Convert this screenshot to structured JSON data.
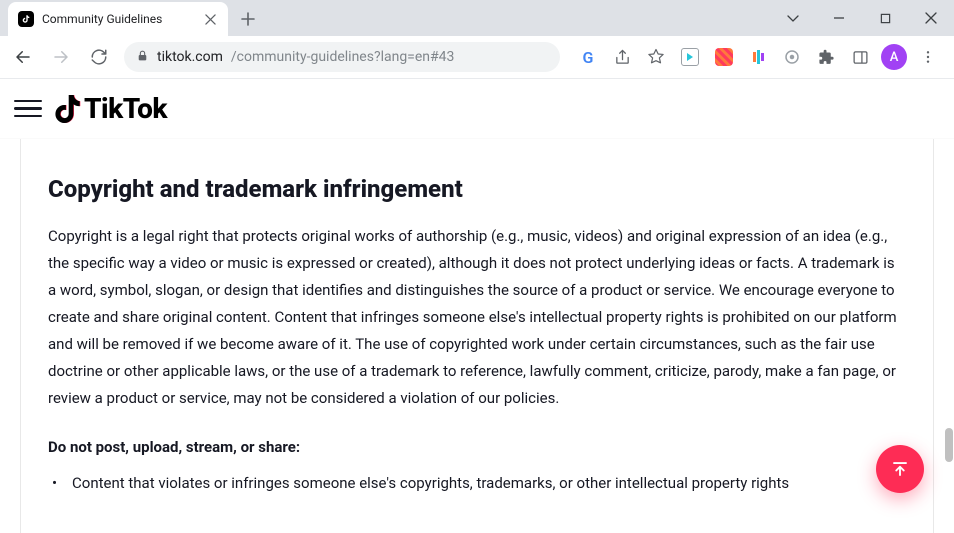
{
  "browser": {
    "tab_title": "Community Guidelines",
    "url_host": "tiktok.com",
    "url_path": "/community-guidelines?lang=en#43",
    "avatar_letter": "A"
  },
  "page": {
    "brand": "TikTok",
    "heading": "Copyright and trademark infringement",
    "paragraph": "Copyright is a legal right that protects original works of authorship (e.g., music, videos) and original expression of an idea (e.g., the specific way a video or music is expressed or created), although it does not protect underlying ideas or facts. A trademark is a word, symbol, slogan, or design that identifies and distinguishes the source of a product or service. We encourage everyone to create and share original content. Content that infringes someone else's intellectual property rights is prohibited on our platform and will be removed if we become aware of it. The use of copyrighted work under certain circumstances, such as the fair use doctrine or other applicable laws, or the use of a trademark to reference, lawfully comment, criticize, parody, make a fan page, or review a product or service, may not be considered a violation of our policies.",
    "prohibit_intro": "Do not post, upload, stream, or share:",
    "bullets": [
      "Content that violates or infringes someone else's copyrights, trademarks, or other intellectual property rights"
    ]
  }
}
